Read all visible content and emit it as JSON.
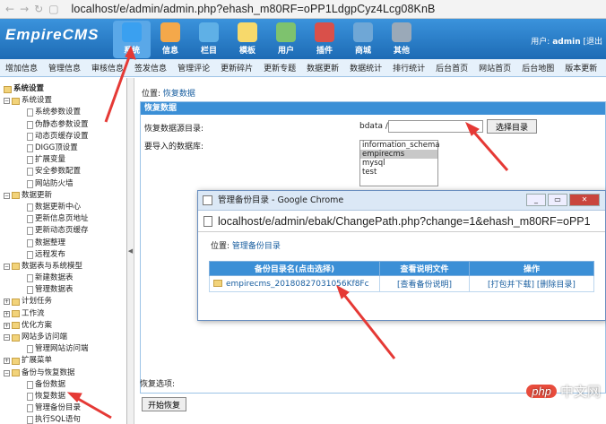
{
  "browser": {
    "url": "localhost/e/admin/admin.php?ehash_m80RF=oPP1LdgpCyz4Lcg08KnB"
  },
  "header": {
    "logo": "EmpireCMS",
    "nav": [
      {
        "label": "系统",
        "icon": "settings-icon"
      },
      {
        "label": "信息",
        "icon": "document-icon"
      },
      {
        "label": "栏目",
        "icon": "folder-icon"
      },
      {
        "label": "模板",
        "icon": "template-icon"
      },
      {
        "label": "用户",
        "icon": "user-icon"
      },
      {
        "label": "插件",
        "icon": "plugin-icon"
      },
      {
        "label": "商城",
        "icon": "shop-icon"
      },
      {
        "label": "其他",
        "icon": "gear-icon"
      }
    ],
    "user_label": "用户:",
    "user_name": "admin",
    "logout": "[退出"
  },
  "menubar": [
    "增加信息",
    "管理信息",
    "审核信息",
    "签发信息",
    "管理评论",
    "更新碎片",
    "更新专题",
    "数据更新",
    "数据统计",
    "排行统计",
    "后台首页",
    "网站首页",
    "后台地图",
    "版本更新"
  ],
  "sidebar": [
    {
      "label": "系统设置",
      "type": "root"
    },
    {
      "label": "系统设置",
      "type": "folder"
    },
    {
      "label": "系统参数设置",
      "type": "file"
    },
    {
      "label": "伪静态参数设置",
      "type": "file"
    },
    {
      "label": "动态页缓存设置",
      "type": "file"
    },
    {
      "label": "DIGG顶设置",
      "type": "file"
    },
    {
      "label": "扩展变量",
      "type": "file"
    },
    {
      "label": "安全参数配置",
      "type": "file"
    },
    {
      "label": "网站防火墙",
      "type": "file"
    },
    {
      "label": "数据更新",
      "type": "folder"
    },
    {
      "label": "数据更新中心",
      "type": "file"
    },
    {
      "label": "更新信息页地址",
      "type": "file"
    },
    {
      "label": "更新动态页缓存",
      "type": "file"
    },
    {
      "label": "数据整理",
      "type": "file"
    },
    {
      "label": "远程发布",
      "type": "file"
    },
    {
      "label": "数据表与系统模型",
      "type": "folder"
    },
    {
      "label": "新建数据表",
      "type": "file"
    },
    {
      "label": "管理数据表",
      "type": "file"
    },
    {
      "label": "计划任务",
      "type": "closed"
    },
    {
      "label": "工作流",
      "type": "closed"
    },
    {
      "label": "优化方案",
      "type": "closed"
    },
    {
      "label": "网站多访问端",
      "type": "folder"
    },
    {
      "label": "管理网站访问端",
      "type": "file"
    },
    {
      "label": "扩展菜单",
      "type": "closed"
    },
    {
      "label": "备份与恢复数据",
      "type": "folder"
    },
    {
      "label": "备份数据",
      "type": "file"
    },
    {
      "label": "恢复数据",
      "type": "file"
    },
    {
      "label": "管理备份目录",
      "type": "file"
    },
    {
      "label": "执行SQL语句",
      "type": "file"
    }
  ],
  "main": {
    "crumb_prefix": "位置:",
    "crumb_link": "恢复数据",
    "table_title": "恢复数据",
    "source_label": "恢复数据源目录:",
    "source_prefix": "bdata /",
    "source_value": "",
    "select_dir_btn": "选择目录",
    "db_label": "要导入的数据库:",
    "databases": [
      "information_schema",
      "empirecms",
      "mysql",
      "test"
    ],
    "selected_db": "empirecms",
    "options_label": "恢复选项:",
    "start_btn": "开始恢复"
  },
  "popup": {
    "title": "管理备份目录 - Google Chrome",
    "url": "localhost/e/admin/ebak/ChangePath.php?change=1&ehash_m80RF=oPP1",
    "crumb_prefix": "位置:",
    "crumb_link": "管理备份目录",
    "columns": [
      "备份目录名(点击选择)",
      "查看说明文件",
      "操作"
    ],
    "rows": [
      {
        "name": "empirecms_20180827031056Kf8Fc",
        "readme": "[查看备份说明]",
        "ops": "[打包并下载]  [删除目录]"
      }
    ]
  },
  "watermark": {
    "badge": "php",
    "text": "中文网"
  }
}
